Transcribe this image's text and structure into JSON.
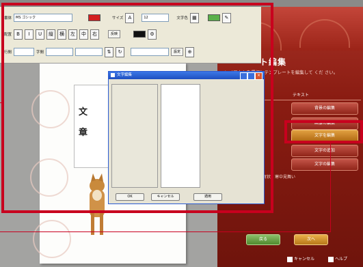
{
  "right_panel": {
    "title": "ト編集",
    "description": "レイアウトを選択しテンプレートを編集して くだ さい。",
    "section_label": "テキスト",
    "buttons": [
      "背景の編集",
      "画像の編集",
      "文字を編集",
      "文字の追加",
      "文字の編集"
    ],
    "active_button_index": 2,
    "bottom_text": "年賀状・寒中見舞い",
    "ok_label": "戻る",
    "next_label": "次へ",
    "footer_left": "キャンセル",
    "footer_right": "ヘルプ"
  },
  "toolbar": {
    "font_label": "書体",
    "font_value": "MS ゴシック",
    "size_label": "サイズ",
    "size_value": "12",
    "style_icons": [
      "B",
      "I",
      "U",
      "縦",
      "横",
      "左",
      "中",
      "右"
    ],
    "color_label": "文字色",
    "align_label": "配置",
    "row3_label": "行間",
    "spacing_label": "字間",
    "buttons": [
      "反映",
      "設定"
    ],
    "font_color": "#d32020",
    "bg_color": "#111111"
  },
  "dialog": {
    "title": "文字編集",
    "buttons": [
      "OK",
      "キャンセル",
      "適用"
    ]
  },
  "paper": {
    "chars": [
      "文",
      "章"
    ]
  },
  "colors": {
    "highlight": "#c8001e",
    "panel": "#8a1c12",
    "active": "#c07818"
  }
}
